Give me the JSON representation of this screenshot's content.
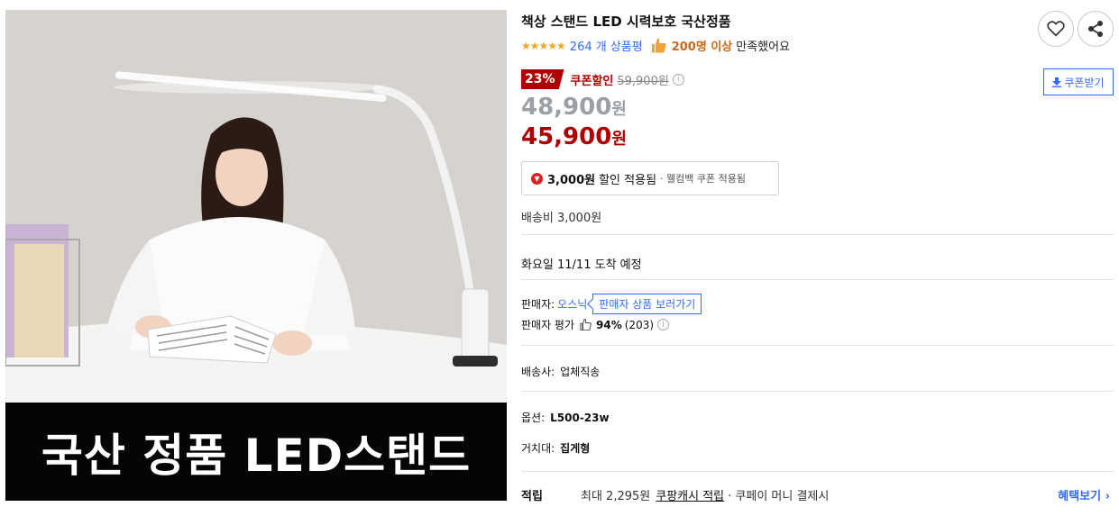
{
  "product": {
    "title": "책상 스탠드 LED 시력보호 국산정품",
    "image_banner": "국산 정품 LED스탠드"
  },
  "rating": {
    "stars": "★★★★★",
    "review_count": "264 개 상품평",
    "satisfaction_strong": "200명 이상",
    "satisfaction_rest": "만족했어요"
  },
  "discount": {
    "badge": "23%",
    "coupon_label": "쿠폰할인",
    "original_price": "59,900원",
    "info_icon": "ⓘ"
  },
  "coupon_button": {
    "label": "쿠폰받기",
    "icon": "download-icon"
  },
  "prices": {
    "sale_price": "48,900",
    "sale_unit": "원",
    "coupon_price": "45,900",
    "coupon_unit": "원"
  },
  "applied_coupon": {
    "amount": "3,000원",
    "text": "할인 적용됨",
    "note": "· 웰컴백 쿠폰 적용됨"
  },
  "shipping": {
    "fee": "배송비 3,000원",
    "arrival": "화요일 11/11 도착 예정"
  },
  "seller": {
    "label": "판매자:",
    "name": "오스닉",
    "link": "판매자 상품 보러가기",
    "eval_label": "판매자 평가",
    "eval_pct": "94%",
    "eval_count": "(203)"
  },
  "details": {
    "carrier_label": "배송사:",
    "carrier_value": "업체직송",
    "option_label": "옵션:",
    "option_value": "L500-23w",
    "mount_label": "거치대:",
    "mount_value": "집게형"
  },
  "reward": {
    "label": "적립",
    "text_max": "최대 2,295원",
    "link": "쿠팡캐시 적립",
    "text_rest": "· 쿠페이 머니 결제시",
    "more": "혜택보기 ›"
  },
  "colors": {
    "accent_blue": "#346aff",
    "discount_red": "#ae0000",
    "gray_price": "#9aa0a6"
  }
}
